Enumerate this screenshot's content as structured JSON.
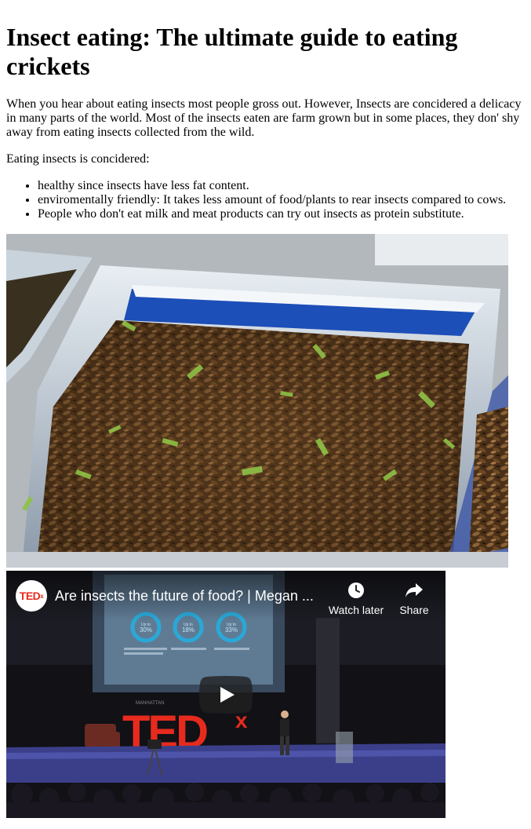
{
  "article": {
    "title": "Insect eating: The ultimate guide to eating crickets",
    "intro": "When you hear about eating insects most people gross out. However, Insects are concidered a delicacy in many parts of the world. Most of the insects eaten are farm grown but in some places, they don' shy away from eating insects collected from the wild.",
    "list_heading": "Eating insects is concidered:",
    "benefits": [
      "healthy since insects have less fat content.",
      "enviromentally friendly: It takes less amount of food/plants to rear insects compared to cows.",
      "People who don't eat milk and meat products can try out insects as protein substitute."
    ]
  },
  "video": {
    "channel_logo": "TED",
    "channel_logo_sup": "x",
    "title": "Are insects the future of food? | Megan ...",
    "watch_later_label": "Watch later",
    "share_label": "Share",
    "slide_stats": [
      "Up to 30%",
      "Up to 18%",
      "Up to 33%"
    ],
    "stage_logo": "TED",
    "stage_logo_sup": "x",
    "stage_small_text": "MANHATTAN",
    "accent_color": "#e62b1e"
  }
}
